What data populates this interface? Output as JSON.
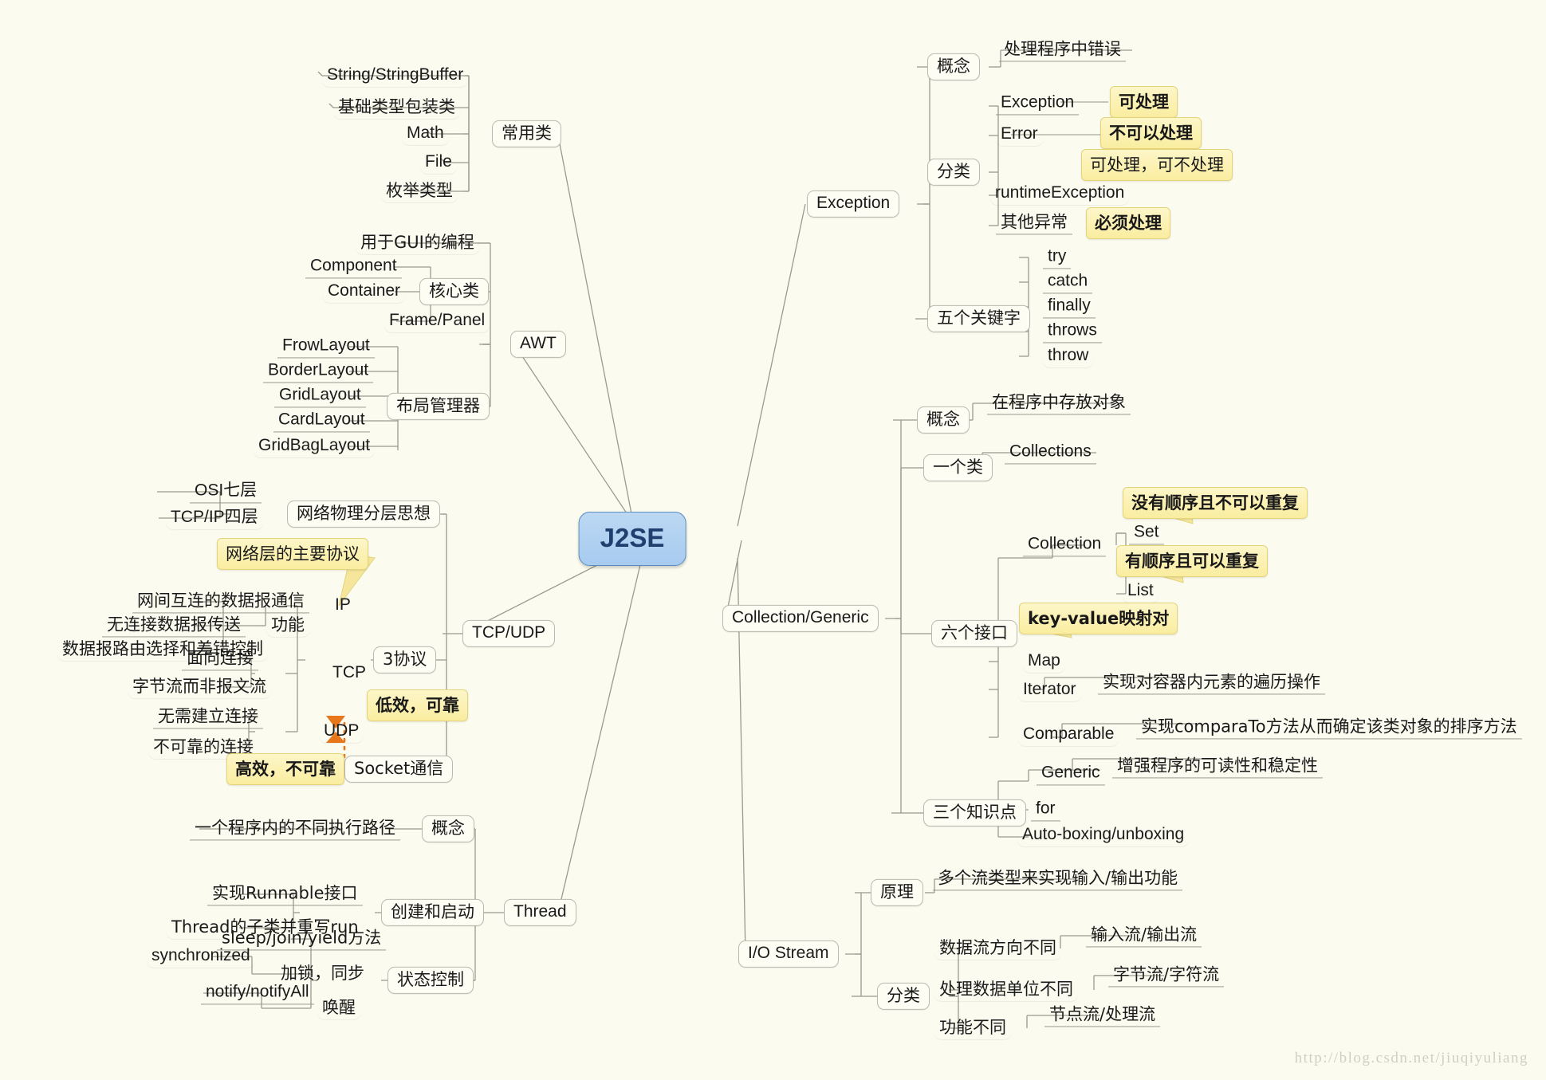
{
  "title": "J2SE",
  "watermark": "http://blog.csdn.net/jiuqiyuliang",
  "colors": {
    "background": "#fbfbef",
    "center_fill": "#a7cbef",
    "center_border": "#5a8cc0",
    "callout_fill": "#faeda0",
    "callout_border": "#e3d47c",
    "node_border": "#b9b9ae",
    "line": "#9a9a8e",
    "dotted_marker": "#e8761a",
    "watermark": "#cfcfc4"
  },
  "center": {
    "label": "J2SE"
  },
  "branches": [
    {
      "id": "common-classes",
      "label": "常用类",
      "children": [
        {
          "label": "String/StringBuffer"
        },
        {
          "label": "基础类型包装类"
        },
        {
          "label": "Math"
        },
        {
          "label": "File"
        },
        {
          "label": "枚举类型"
        }
      ]
    },
    {
      "id": "awt",
      "label": "AWT",
      "children": [
        {
          "label": "用于GUI的编程"
        },
        {
          "label": "核心类",
          "children": [
            {
              "label": "Component"
            },
            {
              "label": "Container"
            },
            {
              "label": "Frame/Panel"
            }
          ]
        },
        {
          "label": "布局管理器",
          "children": [
            {
              "label": "FrowLayout"
            },
            {
              "label": "BorderLayout"
            },
            {
              "label": "GridLayout"
            },
            {
              "label": "CardLayout"
            },
            {
              "label": "GridBagLayout"
            }
          ]
        }
      ]
    },
    {
      "id": "tcp-udp",
      "label": "TCP/UDP",
      "children": [
        {
          "label": "网络物理分层思想",
          "children": [
            {
              "label": "OSI七层"
            },
            {
              "label": "TCP/IP四层"
            }
          ]
        },
        {
          "label": "3协议",
          "children": [
            {
              "label": "IP",
              "callout": "网络层的主要协议",
              "children": [
                {
                  "label": "功能",
                  "children": [
                    {
                      "label": "网间互连的数据报通信"
                    },
                    {
                      "label": "无连接数据报传送"
                    },
                    {
                      "label": "数据报路由选择和差错控制"
                    }
                  ]
                }
              ]
            },
            {
              "label": "TCP",
              "callout": "低效，可靠",
              "children": [
                {
                  "label": "面向连接"
                },
                {
                  "label": "字节流而非报文流"
                }
              ]
            },
            {
              "label": "UDP",
              "callout": "高效，不可靠",
              "children": [
                {
                  "label": "无需建立连接"
                },
                {
                  "label": "不可靠的连接"
                }
              ]
            }
          ]
        },
        {
          "label": "Socket通信"
        }
      ]
    },
    {
      "id": "thread",
      "label": "Thread",
      "children": [
        {
          "label": "概念",
          "children": [
            {
              "label": "一个程序内的不同执行路径"
            }
          ]
        },
        {
          "label": "创建和启动",
          "children": [
            {
              "label": "实现Runnable接口"
            },
            {
              "label": "Thread的子类并重写run"
            }
          ]
        },
        {
          "label": "状态控制",
          "children": [
            {
              "label": "sleep/join/yield方法"
            },
            {
              "label": "加锁，同步",
              "children": [
                {
                  "label": "synchronized"
                }
              ]
            },
            {
              "label": "唤醒",
              "children": [
                {
                  "label": "notify/notifyAll"
                }
              ]
            }
          ]
        }
      ]
    },
    {
      "id": "exception",
      "label": "Exception",
      "children": [
        {
          "label": "概念",
          "children": [
            {
              "label": "处理程序中错误"
            }
          ]
        },
        {
          "label": "分类",
          "children": [
            {
              "label": "Exception",
              "callout": "可处理"
            },
            {
              "label": "Error",
              "callout": "不可以处理"
            },
            {
              "label": "runtimeException",
              "callout": "可处理，可不处理"
            },
            {
              "label": "其他异常",
              "callout": "必须处理"
            }
          ]
        },
        {
          "label": "五个关键字",
          "children": [
            {
              "label": "try"
            },
            {
              "label": "catch"
            },
            {
              "label": "finally"
            },
            {
              "label": "throws"
            },
            {
              "label": "throw"
            }
          ]
        }
      ]
    },
    {
      "id": "collection-generic",
      "label": "Collection/Generic",
      "children": [
        {
          "label": "概念",
          "children": [
            {
              "label": "在程序中存放对象"
            }
          ]
        },
        {
          "label": "一个类",
          "children": [
            {
              "label": "Collections"
            }
          ]
        },
        {
          "label": "六个接口",
          "children": [
            {
              "label": "Collection",
              "children": [
                {
                  "label": "Set",
                  "callout": "没有顺序且不可以重复"
                },
                {
                  "label": "List",
                  "callout": "有顺序且可以重复"
                }
              ]
            },
            {
              "label": "Map",
              "callout": "key-value映射对"
            },
            {
              "label": "Iterator",
              "children": [
                {
                  "label": "实现对容器内元素的遍历操作"
                }
              ]
            },
            {
              "label": "Comparable",
              "children": [
                {
                  "label": "实现comparaTo方法从而确定该类对象的排序方法"
                }
              ]
            }
          ]
        },
        {
          "label": "三个知识点",
          "children": [
            {
              "label": "Generic",
              "children": [
                {
                  "label": "增强程序的可读性和稳定性"
                }
              ]
            },
            {
              "label": "for"
            },
            {
              "label": "Auto-boxing/unboxing"
            }
          ]
        }
      ]
    },
    {
      "id": "io-stream",
      "label": "I/O Stream",
      "children": [
        {
          "label": "原理",
          "children": [
            {
              "label": "多个流类型来实现输入/输出功能"
            }
          ]
        },
        {
          "label": "分类",
          "children": [
            {
              "label": "数据流方向不同",
              "children": [
                {
                  "label": "输入流/输出流"
                }
              ]
            },
            {
              "label": "处理数据单位不同",
              "children": [
                {
                  "label": "字节流/字符流"
                }
              ]
            },
            {
              "label": "功能不同",
              "children": [
                {
                  "label": "节点流/处理流"
                }
              ]
            }
          ]
        }
      ]
    }
  ],
  "nodes": {
    "common_classes": "常用类",
    "c_string": "String/StringBuffer",
    "c_wrapper": "基础类型包装类",
    "c_math": "Math",
    "c_file": "File",
    "c_enum": "枚举类型",
    "awt": "AWT",
    "awt_gui": "用于GUI的编程",
    "awt_core": "核心类",
    "awt_component": "Component",
    "awt_container": "Container",
    "awt_frame": "Frame/Panel",
    "awt_layout_mgr": "布局管理器",
    "awt_frow": "FrowLayout",
    "awt_border": "BorderLayout",
    "awt_grid": "GridLayout",
    "awt_card": "CardLayout",
    "awt_gridbag": "GridBagLayout",
    "tcpudp": "TCP/UDP",
    "net_layer_think": "网络物理分层思想",
    "osi": "OSI七层",
    "tcpip4": "TCP/IP四层",
    "three_protocols": "3协议",
    "ip": "IP",
    "ip_callout": "网络层的主要协议",
    "ip_function": "功能",
    "ip_f1": "网间互连的数据报通信",
    "ip_f2": "无连接数据报传送",
    "ip_f3": "数据报路由选择和差错控制",
    "tcp": "TCP",
    "tcp_callout": "低效，可靠",
    "tcp_1": "面向连接",
    "tcp_2": "字节流而非报文流",
    "udp": "UDP",
    "udp_callout": "高效，不可靠",
    "udp_1": "无需建立连接",
    "udp_2": "不可靠的连接",
    "socket": "Socket通信",
    "thread": "Thread",
    "thread_concept": "概念",
    "thread_concept_1": "一个程序内的不同执行路径",
    "thread_create": "创建和启动",
    "thread_create_1": "实现Runnable接口",
    "thread_create_2": "Thread的子类并重写run",
    "thread_state": "状态控制",
    "thread_state_1": "sleep/join/yield方法",
    "thread_lock": "加锁，同步",
    "thread_sync": "synchronized",
    "thread_wake": "唤醒",
    "thread_notify": "notify/notifyAll",
    "exception": "Exception",
    "ex_concept": "概念",
    "ex_concept_1": "处理程序中错误",
    "ex_class": "分类",
    "ex_exception": "Exception",
    "ex_exception_callout": "可处理",
    "ex_error": "Error",
    "ex_error_callout": "不可以处理",
    "ex_runtime": "runtimeException",
    "ex_runtime_callout": "可处理，可不处理",
    "ex_other": "其他异常",
    "ex_other_callout": "必须处理",
    "ex_keywords": "五个关键字",
    "kw_try": "try",
    "kw_catch": "catch",
    "kw_finally": "finally",
    "kw_throws": "throws",
    "kw_throw": "throw",
    "collection": "Collection/Generic",
    "col_concept": "概念",
    "col_concept_1": "在程序中存放对象",
    "col_oneclass": "一个类",
    "col_collections": "Collections",
    "col_six": "六个接口",
    "col_collection": "Collection",
    "col_set": "Set",
    "col_set_callout": "没有顺序且不可以重复",
    "col_list": "List",
    "col_list_callout": "有顺序且可以重复",
    "col_map": "Map",
    "col_map_callout": "key-value映射对",
    "col_iterator": "Iterator",
    "col_iterator_1": "实现对容器内元素的遍历操作",
    "col_comparable": "Comparable",
    "col_comparable_1": "实现comparaTo方法从而确定该类对象的排序方法",
    "col_three": "三个知识点",
    "col_generic": "Generic",
    "col_generic_1": "增强程序的可读性和稳定性",
    "col_for": "for",
    "col_autobox": "Auto-boxing/unboxing",
    "io": "I/O Stream",
    "io_principle": "原理",
    "io_principle_1": "多个流类型来实现输入/输出功能",
    "io_class": "分类",
    "io_dir": "数据流方向不同",
    "io_dir_1": "输入流/输出流",
    "io_unit": "处理数据单位不同",
    "io_unit_1": "字节流/字符流",
    "io_func": "功能不同",
    "io_func_1": "节点流/处理流"
  }
}
